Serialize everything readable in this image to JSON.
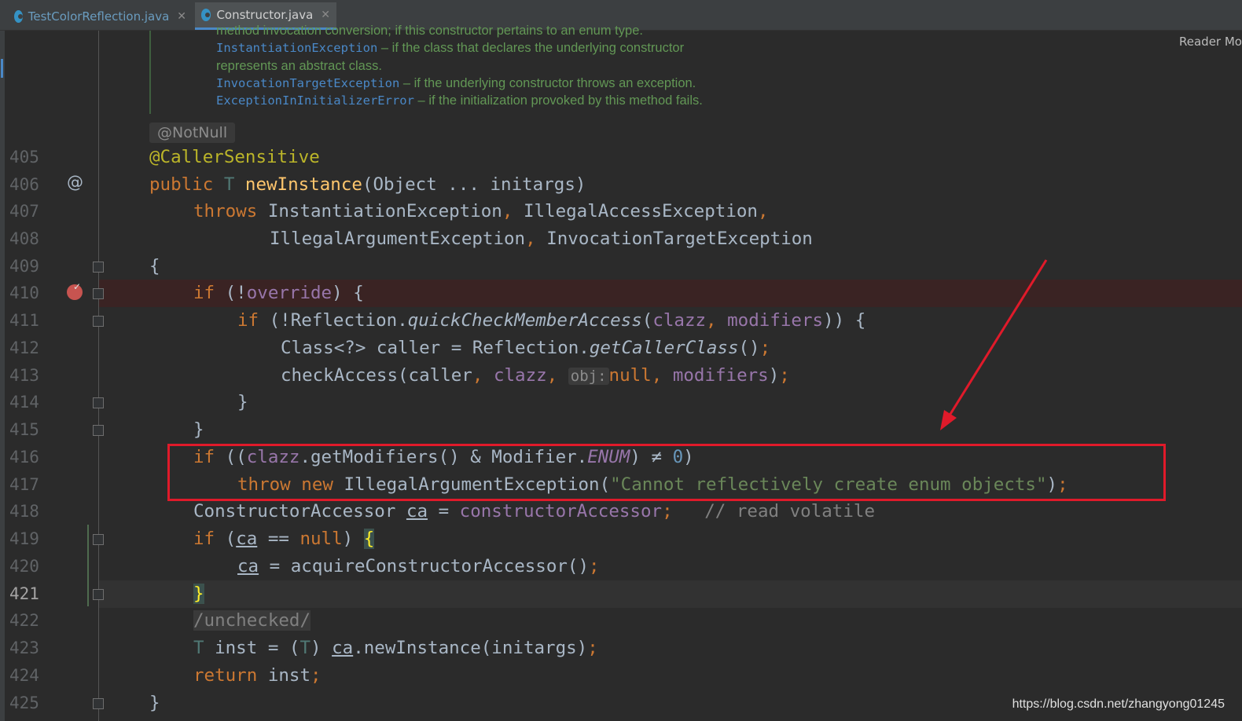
{
  "tabs": [
    {
      "label": "TestColorReflection.java",
      "active": false
    },
    {
      "label": "Constructor.java",
      "active": true
    }
  ],
  "close_glyph": "✕",
  "reader_mode": "Reader Mo",
  "javadoc": {
    "line0": "method invocation conversion; if this constructor pertains to an enum type.",
    "line1_code": "InstantiationException",
    "line1_text": " – if the class that declares the underlying constructor",
    "line2_text": "represents an abstract class.",
    "line3_code": "InvocationTargetException",
    "line3_text": " – if the underlying constructor throws an exception.",
    "line4_code": "ExceptionInInitializerError",
    "line4_text": " – if the initialization provoked by this method fails."
  },
  "inlay_notnull": "@NotNull",
  "line_numbers": [
    "405",
    "406",
    "407",
    "408",
    "409",
    "410",
    "411",
    "412",
    "413",
    "414",
    "415",
    "416",
    "417",
    "418",
    "419",
    "420",
    "421",
    "422",
    "423",
    "424",
    "425"
  ],
  "code": {
    "l405": {
      "ann": "@CallerSensitive"
    },
    "l406": {
      "kw": "public",
      "type": "T",
      "method": "newInstance",
      "rest": "(Object ... initargs)"
    },
    "l407": {
      "kw": "throws",
      "e1": "InstantiationException",
      "c1": ",",
      "e2": "IllegalAccessException",
      "c2": ","
    },
    "l408": {
      "e1": "IllegalArgumentException",
      "c1": ",",
      "e2": "InvocationTargetException"
    },
    "l409": {
      "brace": "{"
    },
    "l410": {
      "kw": "if",
      "p1": " (!",
      "fld": "override",
      "p2": ") {"
    },
    "l411": {
      "kw": "if",
      "p1": " (!Reflection.",
      "m": "quickCheckMemberAccess",
      "p2": "(",
      "f1": "clazz",
      "c": ",",
      "f2": "modifiers",
      "p3": ")) {"
    },
    "l412": {
      "p1": "Class<?> caller = Reflection.",
      "m": "getCallerClass",
      "p2": "()",
      "semi": ";"
    },
    "l413": {
      "p1": "checkAccess(caller",
      "c1": ",",
      "f1": "clazz",
      "c2": ",",
      "hint": "obj:",
      "kwnull": "null",
      "c3": ",",
      "f2": "modifiers",
      "p2": ")",
      "semi": ";"
    },
    "l414": {
      "brace": "}"
    },
    "l415": {
      "brace": "}"
    },
    "l416": {
      "kw": "if",
      "p1": " ((",
      "f1": "clazz",
      "p2": ".getModifiers() & Modifier.",
      "enum": "ENUM",
      "p3": ") ≠ ",
      "num": "0",
      "p4": ")"
    },
    "l417": {
      "kw1": "throw",
      "kw2": "new",
      "p1": "IllegalArgumentException(",
      "str": "\"Cannot reflectively create enum objects\"",
      "p2": ")",
      "semi": ";"
    },
    "l418": {
      "p1": "ConstructorAccessor ",
      "var": "ca",
      "p2": " = ",
      "fld": "constructorAccessor",
      "semi": ";",
      "cmt": "// read volatile"
    },
    "l419": {
      "kw": "if",
      "p1": " (",
      "var": "ca",
      "p2": " == ",
      "kwnull": "null",
      "p3": ") ",
      "brace": "{"
    },
    "l420": {
      "var": "ca",
      "p1": " = acquireConstructorAccessor()",
      "semi": ";"
    },
    "l421": {
      "brace": "}"
    },
    "l422": {
      "cmt": "/unchecked/"
    },
    "l423": {
      "type": "T",
      "p1": " inst = (",
      "type2": "T",
      "p2": ") ",
      "var": "ca",
      "p3": ".newInstance(initargs)",
      "semi": ";"
    },
    "l424": {
      "kw": "return",
      "p1": " inst",
      "semi": ";"
    },
    "l425": {
      "brace": "}"
    }
  },
  "gutter": {
    "override_icon": "@",
    "breakpoint_check": "✓"
  },
  "watermark": "https://blog.csdn.net/zhangyong01245",
  "colors": {
    "highlight_box": "#e01a2a",
    "arrow": "#e01a2a",
    "breakpoint_line": "#3a2323"
  }
}
